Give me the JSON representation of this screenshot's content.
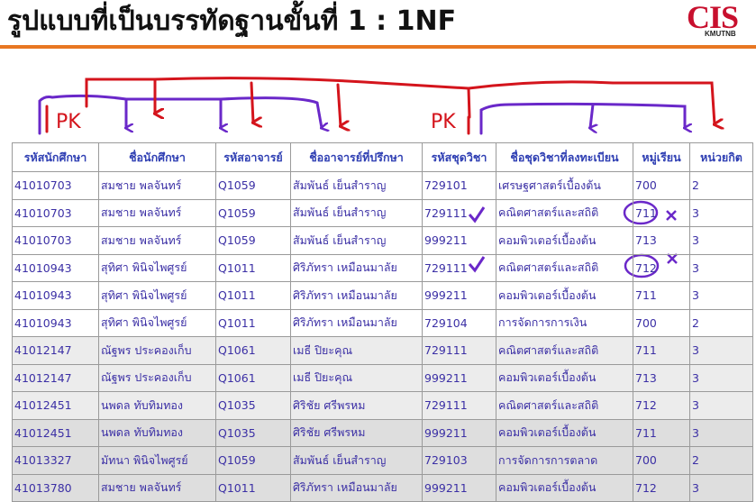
{
  "title": "รูปแบบที่เป็นบรรทัดฐานขั้นที่ 1 : 1NF",
  "logo": {
    "text": "CIS",
    "subtext": "KMUTNB"
  },
  "annotations": {
    "pk_left": "PK",
    "pk_right": "PK",
    "colors": {
      "red": "#d4141c",
      "purple": "#6a28c9",
      "accent": "#e87722",
      "table_text": "#3b2fa5"
    }
  },
  "table": {
    "headers": [
      "รหัสนักศึกษา",
      "ชื่อนักศึกษา",
      "รหัสอาจารย์",
      "ชื่ออาจารย์ที่ปรึกษา",
      "รหัสชุดวิชา",
      "ชื่อชุดวิชาที่ลงทะเบียน",
      "หมู่เรียน",
      "หน่วยกิต"
    ],
    "rows": [
      [
        "41010703",
        "สมชาย  พลจันทร์",
        "Q1059",
        "สัมพันธ์  เย็นสำราญ",
        "729101",
        "เศรษฐศาสตร์เบื้องต้น",
        "700",
        "2"
      ],
      [
        "41010703",
        "สมชาย  พลจันทร์",
        "Q1059",
        "สัมพันธ์  เย็นสำราญ",
        "729111",
        "คณิตศาสตร์และสถิติ",
        "711",
        "3"
      ],
      [
        "41010703",
        "สมชาย  พลจันทร์",
        "Q1059",
        "สัมพันธ์  เย็นสำราญ",
        "999211",
        "คอมพิวเตอร์เบื้องต้น",
        "713",
        "3"
      ],
      [
        "41010943",
        "สุทิศา  พินิจไพศูรย์",
        "Q1011",
        "ศิริภัทรา  เหมือนมาลัย",
        "729111",
        "คณิตศาสตร์และสถิติ",
        "712",
        "3"
      ],
      [
        "41010943",
        "สุทิศา  พินิจไพศูรย์",
        "Q1011",
        "ศิริภัทรา  เหมือนมาลัย",
        "999211",
        "คอมพิวเตอร์เบื้องต้น",
        "711",
        "3"
      ],
      [
        "41010943",
        "สุทิศา  พินิจไพศูรย์",
        "Q1011",
        "ศิริภัทรา  เหมือนมาลัย",
        "729104",
        "การจัดการการเงิน",
        "700",
        "2"
      ],
      [
        "41012147",
        "ณัฐพร  ประคองเก็บ",
        "Q1061",
        "เมธี  ปิยะคุณ",
        "729111",
        "คณิตศาสตร์และสถิติ",
        "711",
        "3"
      ],
      [
        "41012147",
        "ณัฐพร  ประคองเก็บ",
        "Q1061",
        "เมธี  ปิยะคุณ",
        "999211",
        "คอมพิวเตอร์เบื้องต้น",
        "713",
        "3"
      ],
      [
        "41012451",
        "นพดล  ทับทิมทอง",
        "Q1035",
        "ศิริชัย  ศรีพรหม",
        "729111",
        "คณิตศาสตร์และสถิติ",
        "712",
        "3"
      ],
      [
        "41012451",
        "นพดล  ทับทิมทอง",
        "Q1035",
        "ศิริชัย  ศรีพรหม",
        "999211",
        "คอมพิวเตอร์เบื้องต้น",
        "711",
        "3"
      ],
      [
        "41013327",
        "มัทนา  พินิจไพศูรย์",
        "Q1059",
        "สัมพันธ์  เย็นสำราญ",
        "729103",
        "การจัดการการตลาด",
        "700",
        "2"
      ],
      [
        "41013780",
        "สมชาย  พลจันทร์",
        "Q1011",
        "ศิริภัทรา  เหมือนมาลัย",
        "999211",
        "คอมพิวเตอร์เบื้องต้น",
        "712",
        "3"
      ]
    ]
  }
}
